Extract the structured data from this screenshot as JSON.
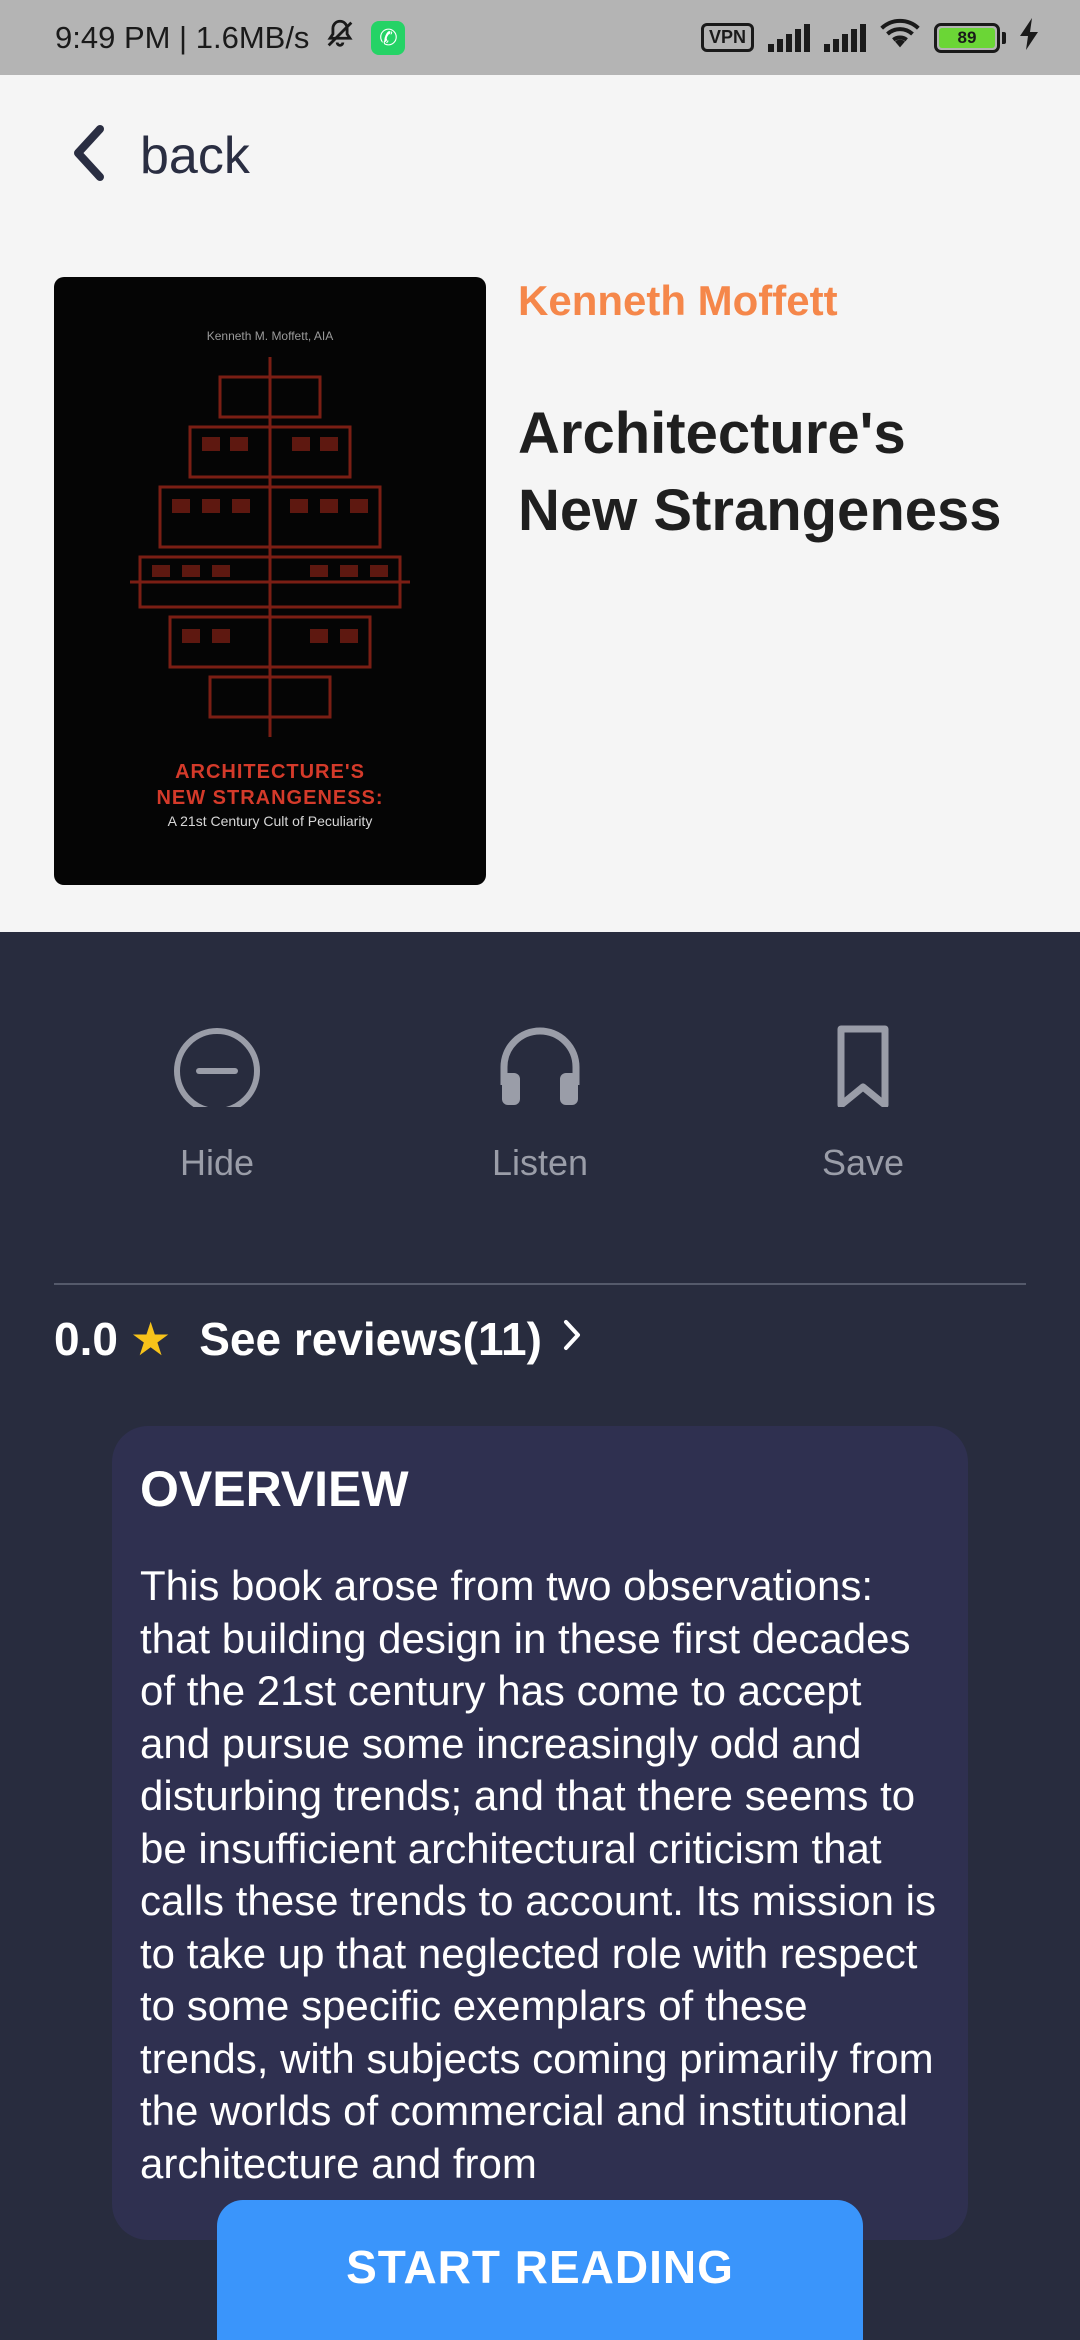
{
  "status_bar": {
    "time_speed": "9:49 PM | 1.6MB/s",
    "vpn": "VPN",
    "battery": "89"
  },
  "nav": {
    "back_label": "back"
  },
  "book": {
    "author": "Kenneth Moffett",
    "title": "Architecture's New Strangeness",
    "cover": {
      "author_line": "Kenneth M. Moffett, AIA",
      "title_line1": "ARCHITECTURE'S",
      "title_line2": "NEW STRANGENESS:",
      "subtitle": "A 21st Century Cult of Peculiarity"
    }
  },
  "actions": {
    "hide_label": "Hide",
    "listen_label": "Listen",
    "save_label": "Save"
  },
  "rating": {
    "score": "0.0",
    "reviews_label": "See reviews(11)"
  },
  "overview": {
    "heading": "OVERVIEW",
    "text": "This book arose from two observations: that building design in these first decades of the 21st century has come to accept and pursue some increasingly odd and disturbing trends; and that there seems to be insufficient architectural criticism that calls these trends to account. Its mission is to take up that neglected role with respect to some specific exemplars of these trends, with subjects coming primarily from the worlds of commercial and institutional architecture and from"
  },
  "cta": {
    "start_label": "START READING"
  },
  "colors": {
    "accent_author": "#f5874a",
    "button": "#3a95fb",
    "dark_bg": "#282c3e",
    "overview_bg": "#2f3050",
    "star": "#f7c31a"
  }
}
